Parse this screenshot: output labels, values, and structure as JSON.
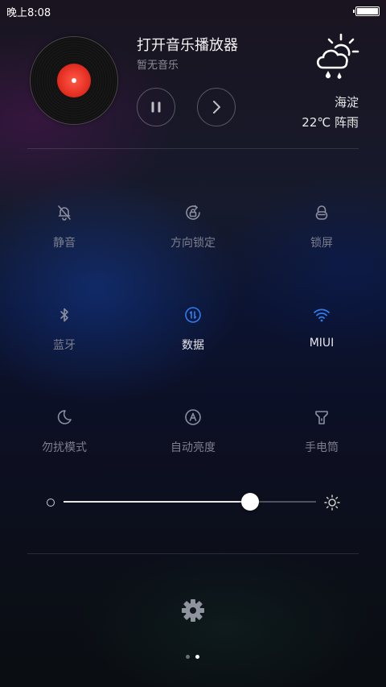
{
  "status_bar": {
    "time": "晚上8:08",
    "battery_level": 1.0
  },
  "music": {
    "title": "打开音乐播放器",
    "subtitle": "暂无音乐",
    "icons": [
      "vinyl-disc-icon",
      "pause-icon",
      "next-icon"
    ]
  },
  "weather": {
    "location": "海淀",
    "temp_condition": "22℃  阵雨",
    "icon": "cloud-sun-rain-icon"
  },
  "toggles": [
    {
      "label": "静音",
      "icon": "mute-bell-icon",
      "active": false
    },
    {
      "label": "方向锁定",
      "icon": "rotation-lock-icon",
      "active": false
    },
    {
      "label": "锁屏",
      "icon": "lock-screen-icon",
      "active": false
    },
    {
      "label": "蓝牙",
      "icon": "bluetooth-icon",
      "active": false
    },
    {
      "label": "数据",
      "icon": "mobile-data-icon",
      "active": true
    },
    {
      "label": "MIUI",
      "icon": "wifi-icon",
      "active": true
    },
    {
      "label": "勿扰模式",
      "icon": "moon-icon",
      "active": false
    },
    {
      "label": "自动亮度",
      "icon": "auto-brightness-icon",
      "active": false
    },
    {
      "label": "手电筒",
      "icon": "flashlight-icon",
      "active": false
    }
  ],
  "brightness": {
    "level": 0.74
  },
  "pager": {
    "pages": 2,
    "current": 2
  },
  "colors": {
    "accent_blue": "#2f7cf0",
    "inactive_icon": "#8c8f9e",
    "inactive_label": "#7d7f8e"
  }
}
